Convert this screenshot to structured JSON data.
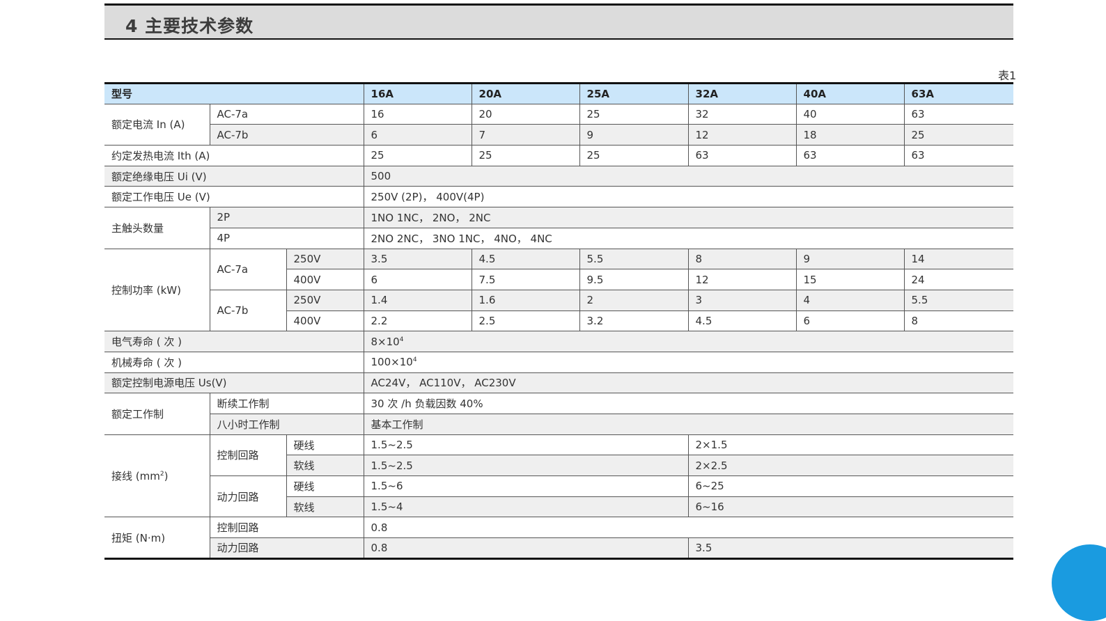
{
  "header": {
    "title": "4 主要技术参数"
  },
  "table_label": "表1",
  "columns": {
    "label": "型号",
    "c1": "16A",
    "c2": "20A",
    "c3": "25A",
    "c4": "32A",
    "c5": "40A",
    "c6": "63A"
  },
  "rated_current": {
    "label": "额定电流 In (A)",
    "ac7a": {
      "label": "AC-7a",
      "values": [
        "16",
        "20",
        "25",
        "32",
        "40",
        "63"
      ]
    },
    "ac7b": {
      "label": "AC-7b",
      "values": [
        "6",
        "7",
        "9",
        "12",
        "18",
        "25"
      ]
    }
  },
  "thermal_current": {
    "label": "约定发热电流 Ith (A)",
    "values": [
      "25",
      "25",
      "25",
      "63",
      "63",
      "63"
    ]
  },
  "insulation_voltage": {
    "label": "额定绝缘电压 Ui (V)",
    "value": "500"
  },
  "working_voltage": {
    "label": "额定工作电压 Ue (V)",
    "value": "250V (2P)， 400V(4P)"
  },
  "main_contacts": {
    "label": "主触头数量",
    "p2": {
      "label": "2P",
      "value": "1NO 1NC， 2NO， 2NC"
    },
    "p4": {
      "label": "4P",
      "value": "2NO 2NC， 3NO 1NC， 4NO， 4NC"
    }
  },
  "control_power": {
    "label": "控制功率 (kW)",
    "ac7a": {
      "label": "AC-7a",
      "v250": {
        "label": "250V",
        "values": [
          "3.5",
          "4.5",
          "5.5",
          "8",
          "9",
          "14"
        ]
      },
      "v400": {
        "label": "400V",
        "values": [
          "6",
          "7.5",
          "9.5",
          "12",
          "15",
          "24"
        ]
      }
    },
    "ac7b": {
      "label": "AC-7b",
      "v250": {
        "label": "250V",
        "values": [
          "1.4",
          "1.6",
          "2",
          "3",
          "4",
          "5.5"
        ]
      },
      "v400": {
        "label": "400V",
        "values": [
          "2.2",
          "2.5",
          "3.2",
          "4.5",
          "6",
          "8"
        ]
      }
    }
  },
  "electrical_life": {
    "label": "电气寿命 ( 次 )",
    "base": "8×10",
    "exp": "4"
  },
  "mechanical_life": {
    "label": "机械寿命 ( 次 )",
    "base": "100×10",
    "exp": "4"
  },
  "control_supply": {
    "label": "额定控制电源电压 Us(V)",
    "value": "AC24V， AC110V， AC230V"
  },
  "duty": {
    "label": "额定工作制",
    "intermittent": {
      "label": "断续工作制",
      "value": "30 次 /h 负载因数 40%"
    },
    "eight_hour": {
      "label": "八小时工作制",
      "value": "基本工作制"
    }
  },
  "wiring": {
    "label_base": "接线 (mm",
    "label_exp": "2",
    "label_end": ")",
    "control": {
      "label": "控制回路",
      "hard": {
        "label": "硬线",
        "a": "1.5~2.5",
        "b": "2×1.5"
      },
      "soft": {
        "label": "软线",
        "a": "1.5~2.5",
        "b": "2×2.5"
      }
    },
    "power": {
      "label": "动力回路",
      "hard": {
        "label": "硬线",
        "a": "1.5~6",
        "b": "6~25"
      },
      "soft": {
        "label": "软线",
        "a": "1.5~4",
        "b": "6~16"
      }
    }
  },
  "torque": {
    "label": "扭矩 (N·m)",
    "control": {
      "label": "控制回路",
      "value": "0.8"
    },
    "power": {
      "label": "动力回路",
      "a": "0.8",
      "b": "3.5"
    }
  }
}
